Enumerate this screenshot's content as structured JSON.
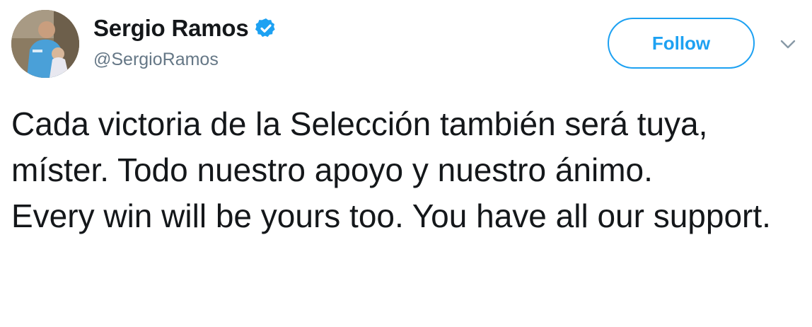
{
  "author": {
    "display_name": "Sergio Ramos",
    "handle": "@SergioRamos",
    "verified": true,
    "avatar_icon": "profile-photo-avatar"
  },
  "actions": {
    "follow_label": "Follow",
    "menu_icon": "chevron-down-icon"
  },
  "tweet": {
    "text_es": "Cada victoria de la Selección también será tuya, míster. Todo nuestro apoyo y nuestro ánimo.",
    "text_en": "Every win will be yours too. You have all our support."
  },
  "colors": {
    "brand_blue": "#1da1f2",
    "text": "#14171a",
    "secondary_text": "#657786"
  }
}
